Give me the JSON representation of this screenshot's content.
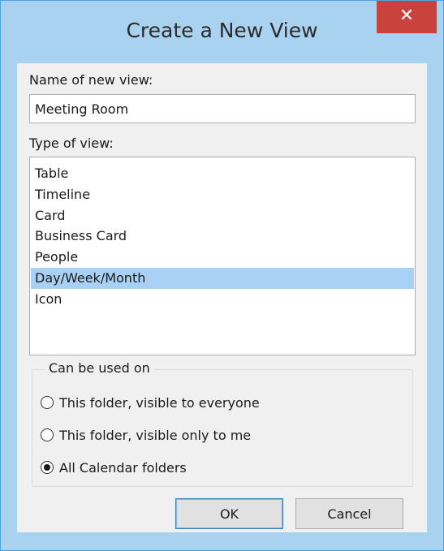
{
  "window": {
    "title": "Create a New View",
    "close_glyph": "✕",
    "accent_color": "#4aa3df",
    "close_color": "#c9423b"
  },
  "name_field": {
    "label": "Name of new view:",
    "value": "Meeting Room"
  },
  "type_list": {
    "label": "Type of view:",
    "items": [
      "Table",
      "Timeline",
      "Card",
      "Business Card",
      "People",
      "Day/Week/Month",
      "Icon"
    ],
    "selected": "Day/Week/Month",
    "selection_color": "#a8d1f5"
  },
  "usage": {
    "legend": "Can be used on",
    "options": [
      {
        "label": "This folder, visible to everyone",
        "checked": false
      },
      {
        "label": "This folder, visible only to me",
        "checked": false
      },
      {
        "label": "All Calendar folders",
        "checked": true
      }
    ]
  },
  "buttons": {
    "ok": "OK",
    "cancel": "Cancel"
  }
}
